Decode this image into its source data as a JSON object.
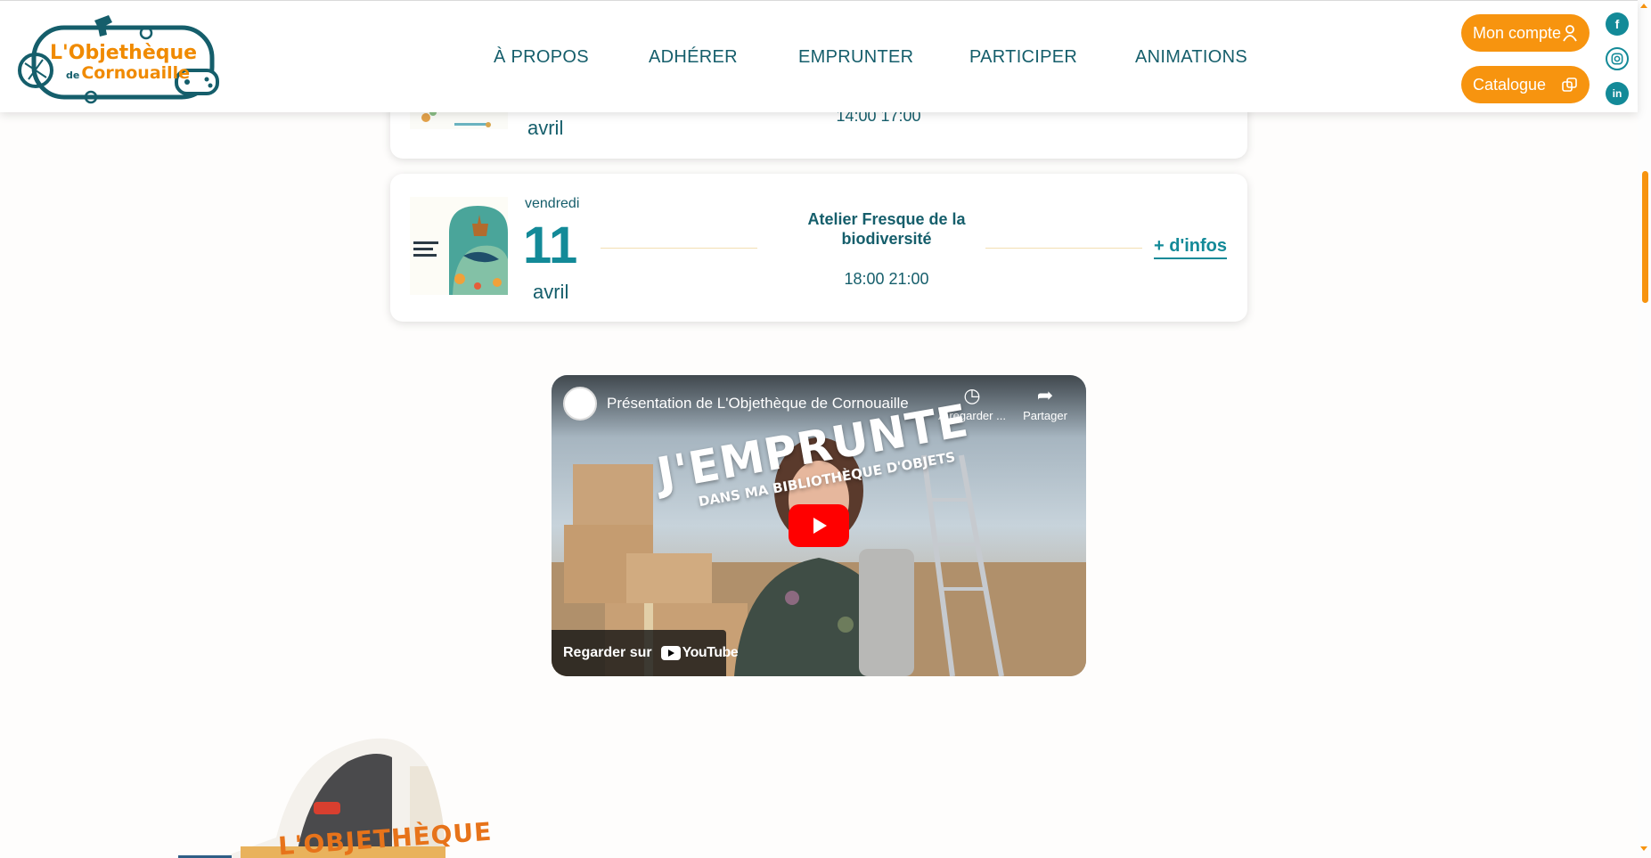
{
  "header": {
    "logo": {
      "line1": "L'Objethèque",
      "line2_prefix": "de",
      "line2": "Cornouaille"
    },
    "nav": [
      "À PROPOS",
      "ADHÉRER",
      "EMPRUNTER",
      "PARTICIPER",
      "ANIMATIONS"
    ],
    "account_button": "Mon compte",
    "catalogue_button": "Catalogue",
    "social": [
      "facebook-icon",
      "instagram-icon",
      "linkedin-icon"
    ]
  },
  "events": [
    {
      "month": "avril",
      "time": "14:00 17:00"
    },
    {
      "weekday": "vendredi",
      "day": "11",
      "month": "avril",
      "title": "Atelier Fresque de la biodiversité",
      "time": "18:00 21:00",
      "more_link": "+ d'infos"
    }
  ],
  "video": {
    "title": "Présentation de L'Objethèque de Cornouaille",
    "watch_later": "À regarder ...",
    "share": "Partager",
    "overlay_big": "J'EMPRUNTE",
    "overlay_small": "DANS MA BIBLIOTHÈQUE D'OBJETS",
    "watch_on": "Regarder sur",
    "youtube": "YouTube"
  },
  "bottom_image_text": "L'OBJETHÈQUE",
  "colors": {
    "teal_dark": "#155e6b",
    "teal": "#138a98",
    "orange": "#f7940f",
    "youtube_red": "#ff0000"
  }
}
